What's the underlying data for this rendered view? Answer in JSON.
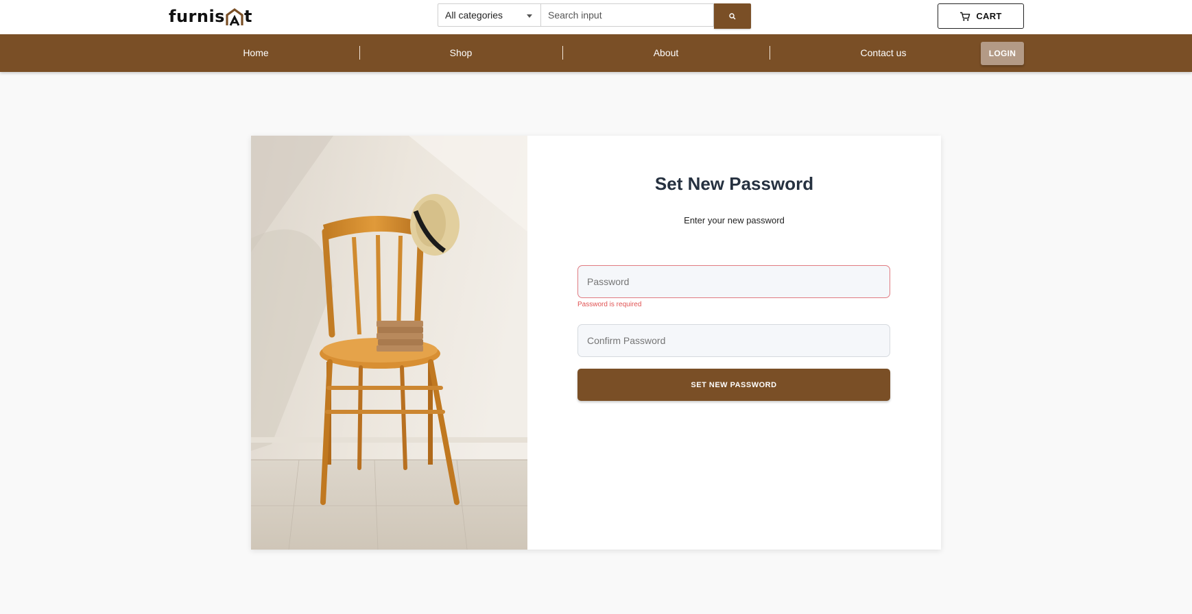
{
  "header": {
    "logo_text_left": "furnis",
    "logo_text_right": "t",
    "category_select": "All categories",
    "search_placeholder": "Search input",
    "cart_label": "CART"
  },
  "nav": {
    "items": [
      {
        "label": "Home"
      },
      {
        "label": "Shop"
      },
      {
        "label": "About"
      },
      {
        "label": "Contact us"
      }
    ],
    "login_label": "LOGIN"
  },
  "form": {
    "title": "Set New Password",
    "subtitle": "Enter your new password",
    "password_placeholder": "Password",
    "password_error": "Password is required",
    "confirm_placeholder": "Confirm Password",
    "submit_label": "SET NEW PASSWORD"
  },
  "colors": {
    "brand": "#7a4f26",
    "login_button": "#b39a86",
    "error": "#e05252",
    "background": "#f9f9f9"
  },
  "icons": {
    "search": "search-icon",
    "cart": "cart-icon",
    "dropdown": "chevron-down-icon"
  }
}
